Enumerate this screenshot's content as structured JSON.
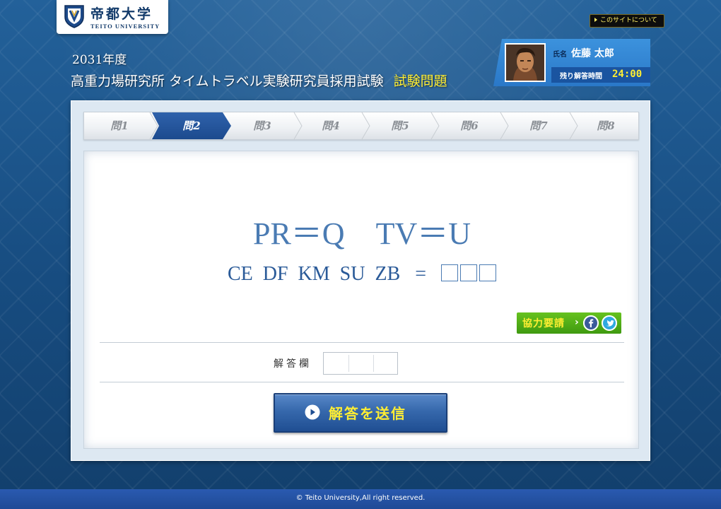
{
  "header": {
    "logo": {
      "name": "帝都大学",
      "english": "TEITO UNIVERSITY"
    },
    "about_link": "このサイトについて",
    "exam_year": "2031年度",
    "exam_title": "高重力場研究所 タイムトラベル実験研究員採用試験",
    "exam_title_accent": "試験問題"
  },
  "profile": {
    "name_label": "氏名",
    "name": "佐藤 太郎",
    "time_label": "残り解答時間",
    "time_remaining": "24:00"
  },
  "tabs": [
    {
      "label": "問1",
      "active": false
    },
    {
      "label": "問2",
      "active": true
    },
    {
      "label": "問3",
      "active": false
    },
    {
      "label": "問4",
      "active": false
    },
    {
      "label": "問5",
      "active": false
    },
    {
      "label": "問6",
      "active": false
    },
    {
      "label": "問7",
      "active": false
    },
    {
      "label": "問8",
      "active": false
    }
  ],
  "question": {
    "hint": "PR＝Q　TV＝U",
    "prompt": "CE  DF  KM  SU  ZB   =   "
  },
  "cooperation_button": "協力要請",
  "social": [
    "facebook-icon",
    "twitter-icon"
  ],
  "answer": {
    "label": "解答欄",
    "value": ""
  },
  "submit_button": "解答を送信",
  "footer": "© Teito University,All right reserved.",
  "colors": {
    "brand_blue": "#1c4a8e",
    "accent_yellow": "#ffee33",
    "coop_green": "#4fae16"
  }
}
